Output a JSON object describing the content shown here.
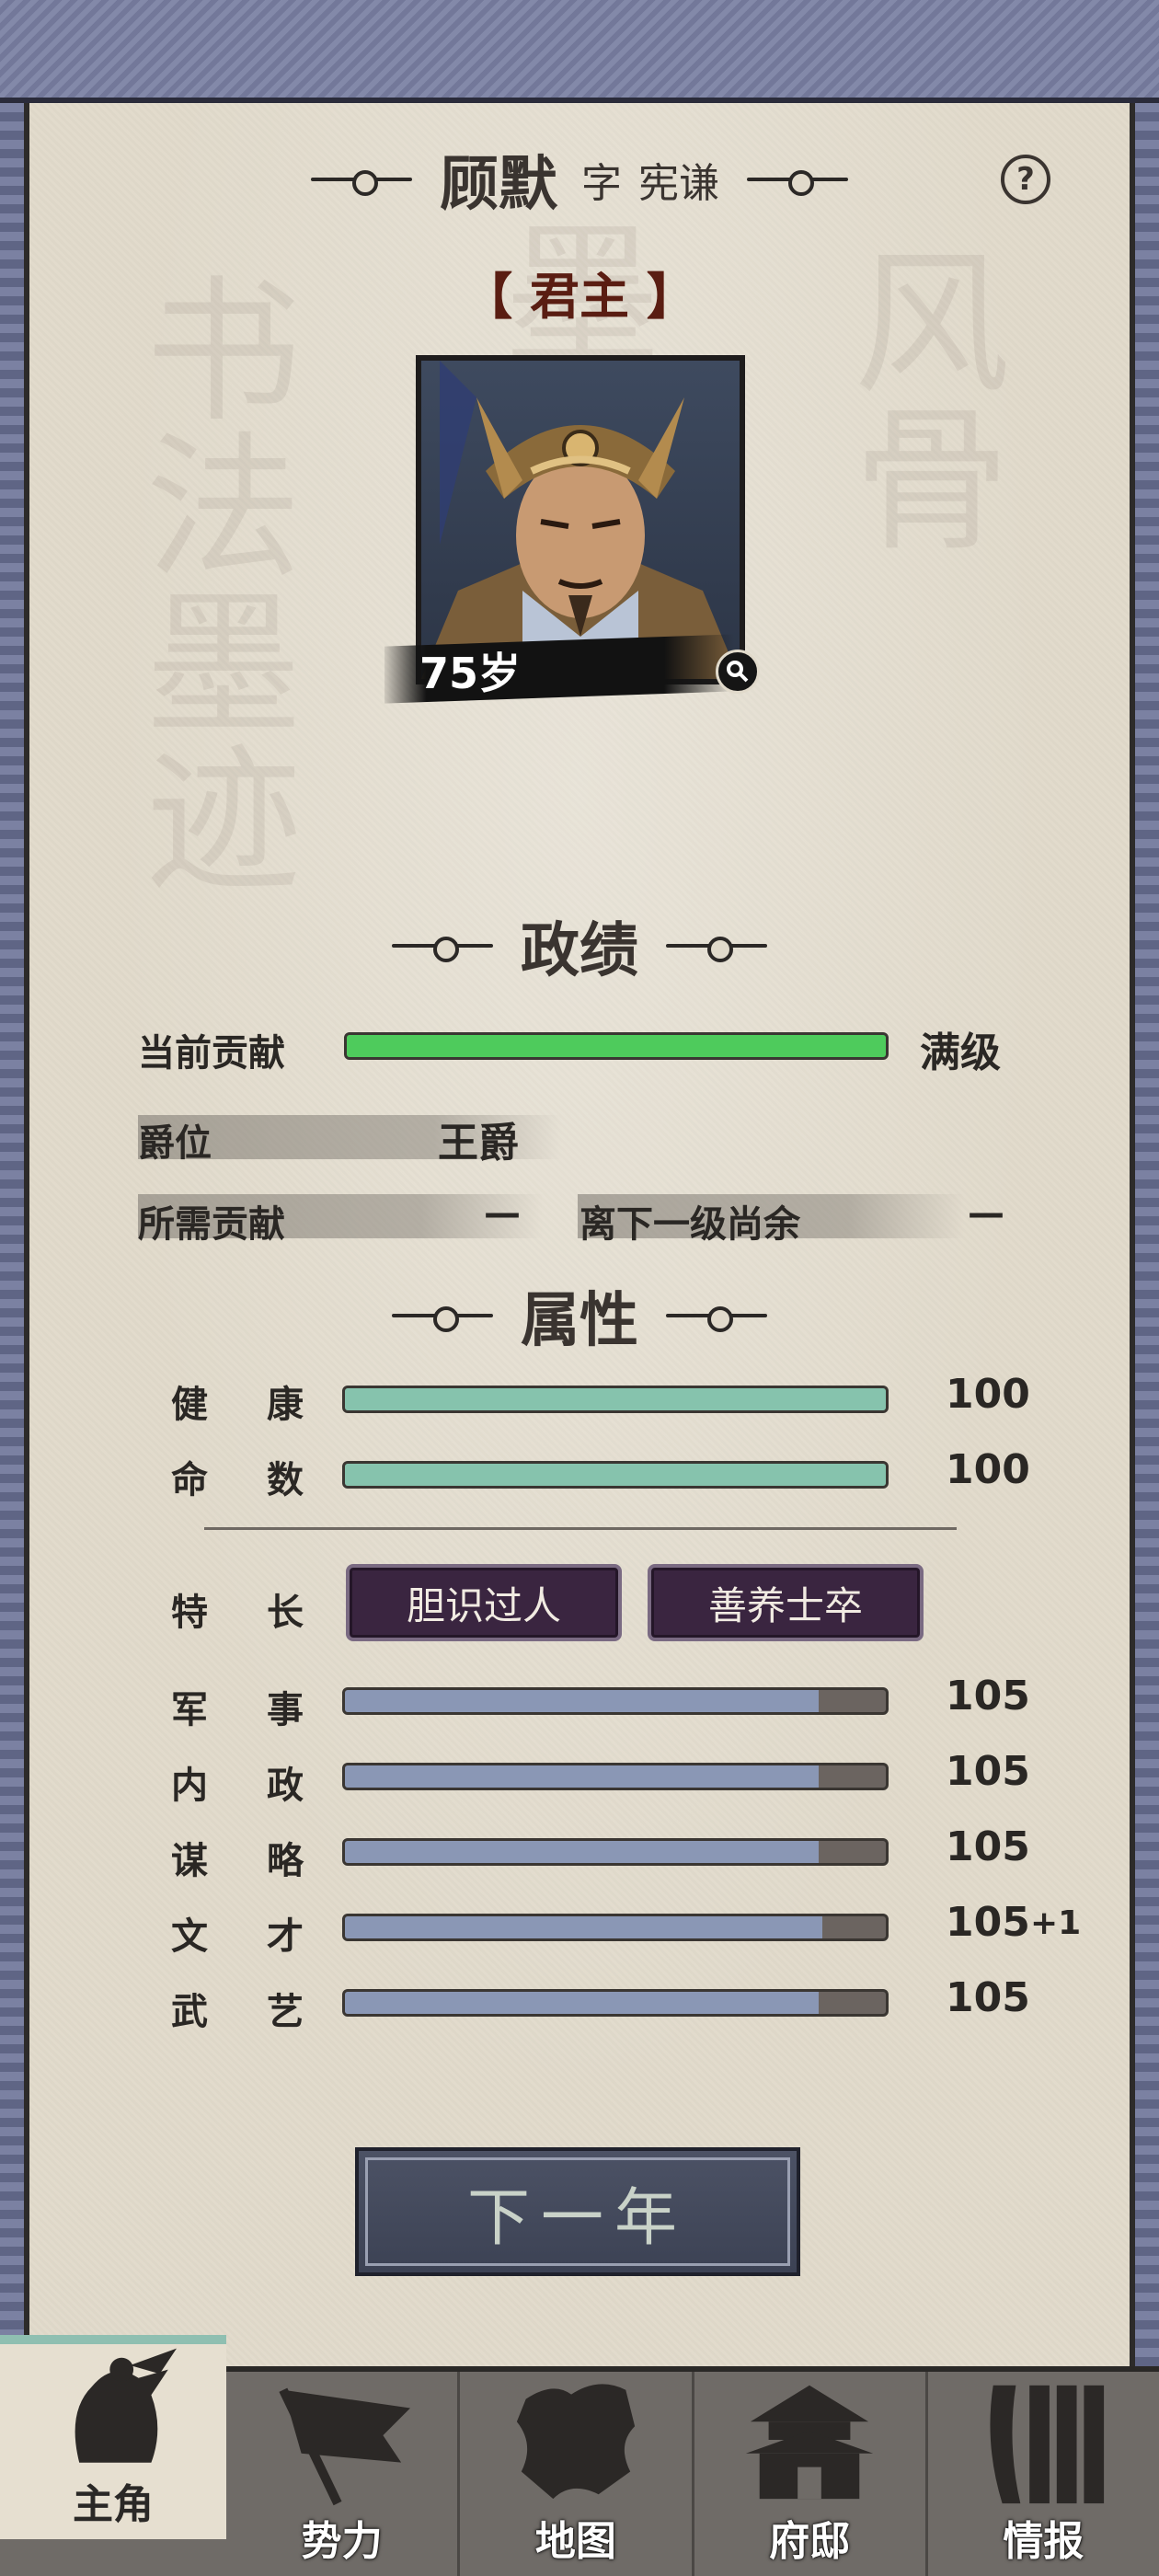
{
  "header": {
    "name": "顾默",
    "zi_label": "字",
    "courtesy_name": "宪谦",
    "help_glyph": "?"
  },
  "role": "【 君主 】",
  "portrait": {
    "age": "75岁"
  },
  "achievements": {
    "title": "政绩",
    "current_contribution_label": "当前贡献",
    "current_contribution_value": "满级",
    "current_contribution_fill": 1.0,
    "rank_label": "爵位",
    "rank_value": "王爵",
    "required_label": "所需贡献",
    "required_value": "—",
    "remaining_label": "离下一级尚余",
    "remaining_value": "—"
  },
  "attributes": {
    "title": "属性",
    "health_label": "健康",
    "health_value": "100",
    "health_fill": 1.0,
    "fate_label": "命数",
    "fate_value": "100",
    "fate_fill": 1.0,
    "specialty_label": "特长",
    "specialties": [
      "胆识过人",
      "善养士卒"
    ],
    "stats": [
      {
        "label": "军事",
        "value": "105",
        "fill": 0.875
      },
      {
        "label": "内政",
        "value": "105",
        "fill": 0.875
      },
      {
        "label": "谋略",
        "value": "105",
        "fill": 0.875
      },
      {
        "label": "文才",
        "value": "105",
        "bonus": "+1",
        "fill": 0.882
      },
      {
        "label": "武艺",
        "value": "105",
        "fill": 0.875
      }
    ]
  },
  "next_year_button": "下一年",
  "bottom_nav": [
    {
      "label": "主角",
      "icon": "hero-icon",
      "active": true
    },
    {
      "label": "势力",
      "icon": "flag-icon",
      "active": false
    },
    {
      "label": "地图",
      "icon": "map-icon",
      "active": false
    },
    {
      "label": "府邸",
      "icon": "mansion-icon",
      "active": false
    },
    {
      "label": "情报",
      "icon": "scroll-icon",
      "active": false
    }
  ],
  "colors": {
    "contribution_bar": "#4ecb5c",
    "health_bar": "#86c3ad",
    "stat_bar": "#8a97b5",
    "tag_bg": "#3a2540",
    "accent_role": "#5a1d12"
  }
}
